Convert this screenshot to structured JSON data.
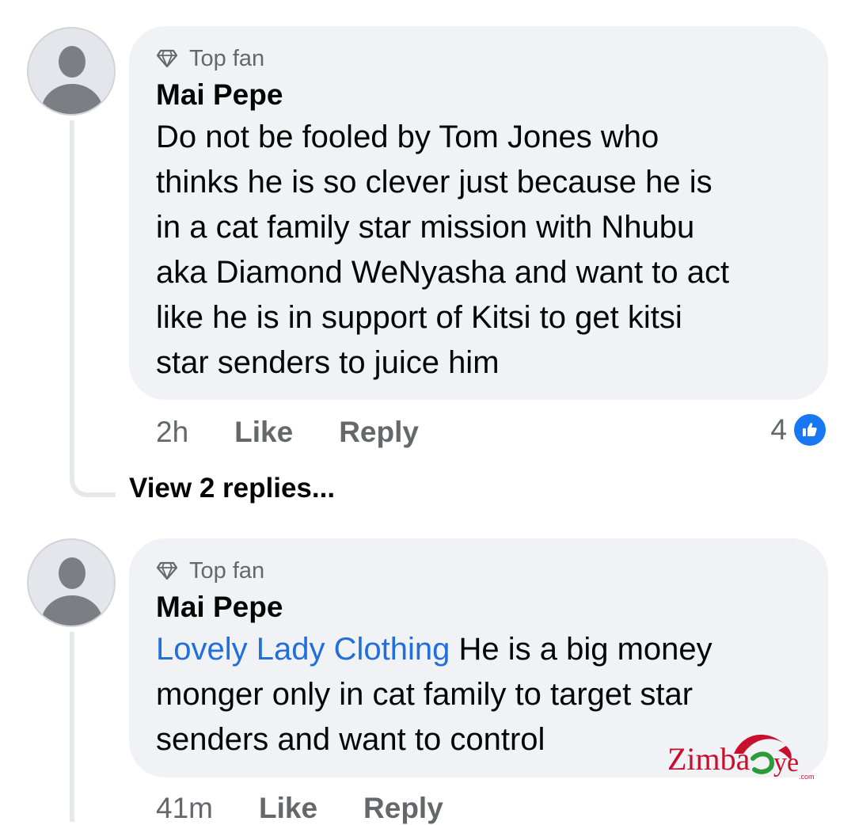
{
  "comments": [
    {
      "badge": "Top fan",
      "author": "Mai Pepe",
      "mention": "",
      "lines": [
        "Do not be fooled by Tom Jones who",
        "thinks he is so clever just because he is",
        "in a cat family star mission with Nhubu",
        "aka Diamond WeNyasha and want to act",
        "like he is in support of Kitsi to get kitsi",
        "star senders to juice him"
      ],
      "time": "2h",
      "like_label": "Like",
      "reply_label": "Reply",
      "reaction_count": "4",
      "reaction_icon": "thumbs-up-icon",
      "view_replies": "View 2 replies..."
    },
    {
      "badge": "Top fan",
      "author": "Mai Pepe",
      "mention": "Lovely Lady Clothing",
      "first_line_rest": " He is a big money",
      "lines": [
        "monger only in cat family to target star",
        "senders and want to control"
      ],
      "time": "41m",
      "like_label": "Like",
      "reply_label": "Reply"
    }
  ],
  "watermark": {
    "text": "Zimba",
    "text_end": "ye",
    "suffix": ".com"
  },
  "colors": {
    "bubble": "#f0f2f5",
    "text": "#050505",
    "muted": "#65676b",
    "mention": "#216fdb",
    "like_blue": "#1877f2",
    "watermark_red": "#c8102e",
    "watermark_green": "#2e9b3a"
  }
}
